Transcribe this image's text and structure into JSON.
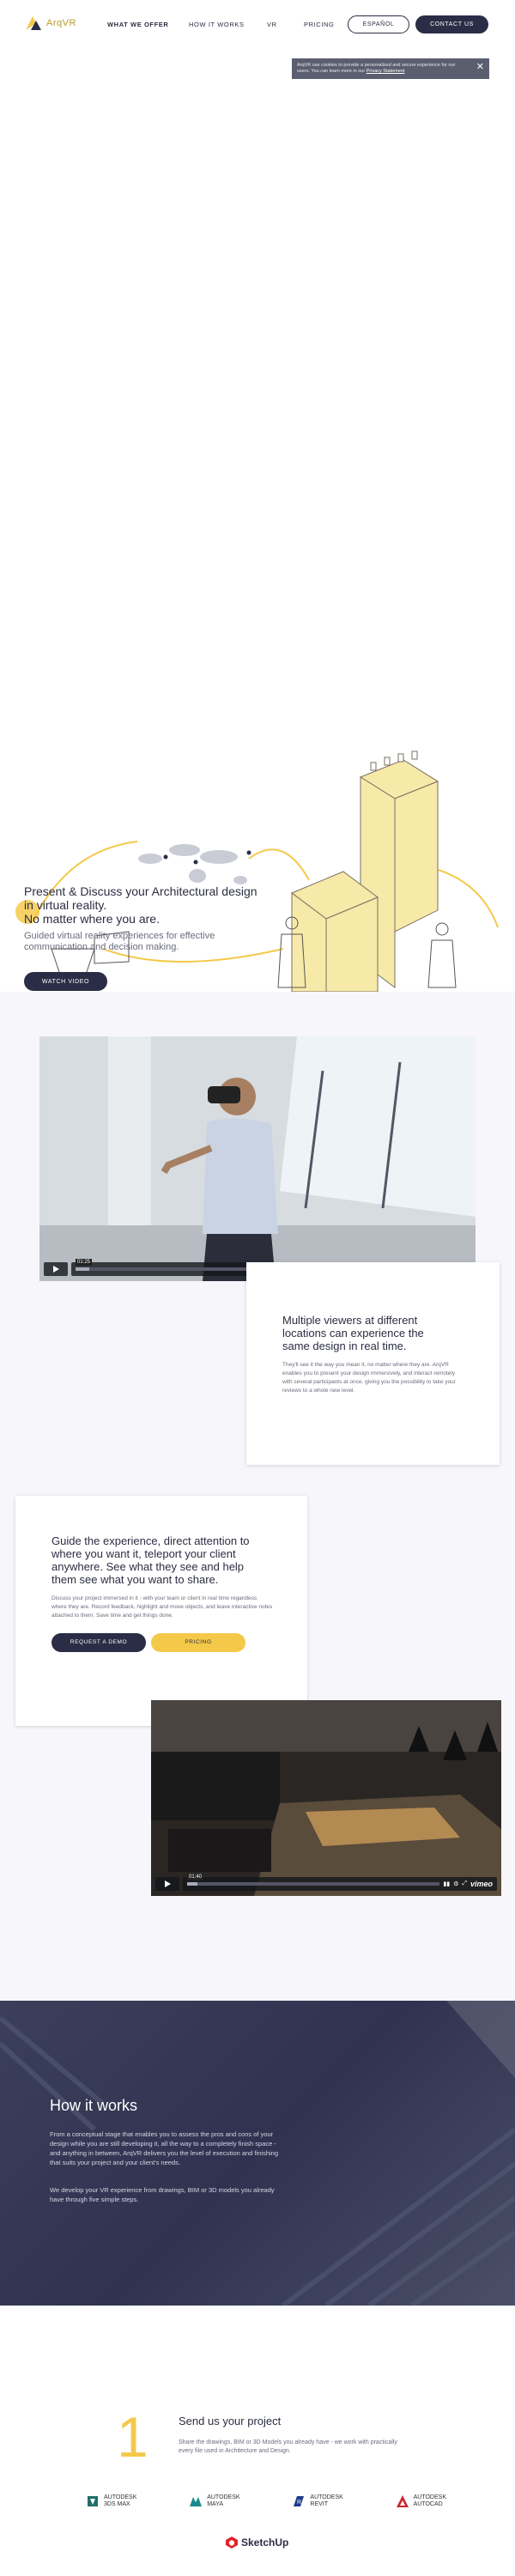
{
  "nav": {
    "logo_text": "ArqVR",
    "links": [
      "WHAT WE OFFER",
      "HOW IT WORKS",
      "VR",
      "PRICING"
    ],
    "language_label": "ESPAÑOL",
    "contact_label": "CONTACT US"
  },
  "cookie": {
    "text": "ArqVR use cookies to provide a personalized and secure experience for our users. You can learn more in our",
    "link_text": "Privacy Statement",
    "close_glyph": "✕"
  },
  "hero": {
    "title_lines": [
      "Present & Discuss your Architectural design",
      "in virtual reality.",
      "No matter where you are."
    ],
    "subtitle_lines": [
      "Guided virtual reality experiences for effective",
      "communication and decision making."
    ],
    "watch_label": "WATCH VIDEO"
  },
  "video1": {
    "time": "01:25"
  },
  "card1": {
    "title_lines": [
      "Multiple viewers at different",
      "locations can experience the",
      "same design in real time."
    ],
    "text": "They'll see it the way you mean it, no matter where they are. ArqVR enables you to present your design immersively, and interact remotely with several participants at once, giving you the possibility to take your reviews to a whole new level."
  },
  "card2": {
    "title_lines": [
      "Guide the experience, direct attention to",
      "where you want it, teleport your client",
      "anywhere. See what they see and help",
      "them see what you want to share."
    ],
    "text": "Discuss your project immersed in it - with your team or client in real time regardless where they are. Record feedback, highlight and move objects, and leave interactive notes attached to them. Save time and get things done.",
    "demo_label": "REQUEST A DEMO",
    "pricing_label": "PRICING"
  },
  "video2": {
    "time": "01:40"
  },
  "how": {
    "title": "How it works",
    "text1": "From a conceptual stage that enables you to assess the pros and cons of your design while you are still developing it, all the way to a completely finish space - and anything in between, ArqVR delivers you the level of execution and finishing that suits your project and your client's needs.",
    "text2": "We develop your VR experience from drawings, BIM or 3D models you already have through five simple steps."
  },
  "step": {
    "number": "1",
    "title": "Send us your project",
    "text": "Share the drawings, BIM or 3D Models you already have - we work with practically every file used in Architecture and Design."
  },
  "brands": [
    {
      "line1": "AUTODESK",
      "line2": "3DS MAX",
      "color": "#1f6f6a"
    },
    {
      "line1": "AUTODESK",
      "line2": "MAYA",
      "color": "#1b8a8c"
    },
    {
      "line1": "AUTODESK",
      "line2": "REVIT",
      "color": "#1f3a8a"
    },
    {
      "line1": "AUTODESK",
      "line2": "AUTOCAD",
      "color": "#c8262d"
    }
  ],
  "sketchup": {
    "name": "SketchUp"
  },
  "colors": {
    "accent": "#f4c94a",
    "dark": "#2a2d45",
    "cookie": "#5b5e6f"
  }
}
